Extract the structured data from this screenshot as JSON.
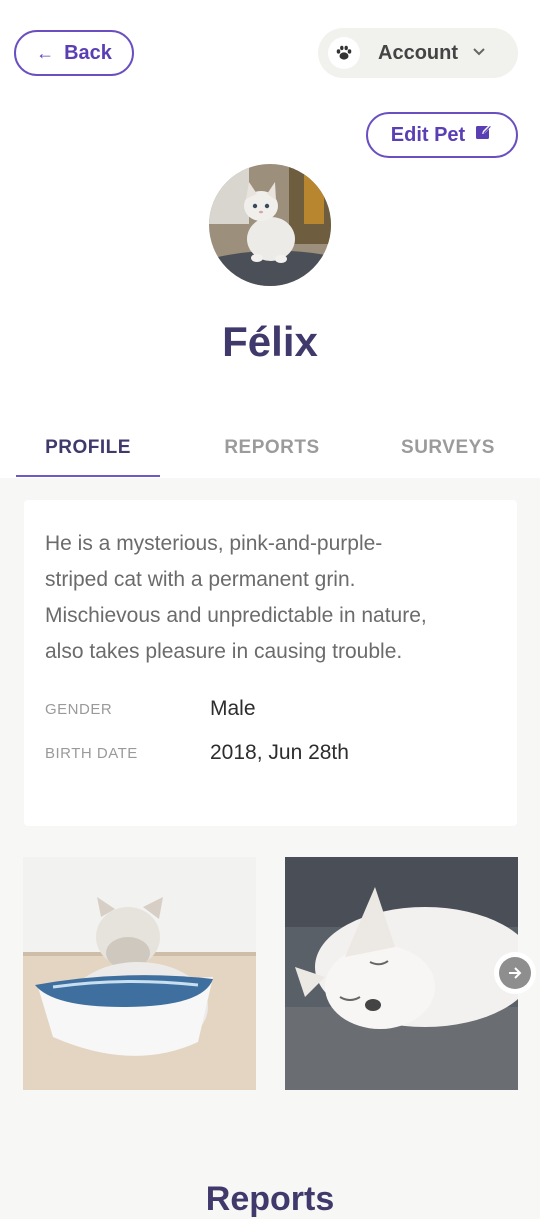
{
  "header": {
    "back_label": "Back",
    "account_label": "Account"
  },
  "actions": {
    "edit_pet_label": "Edit Pet"
  },
  "pet": {
    "name": "Félix",
    "description": "He is a mysterious, pink-and-purple-striped cat with a permanent grin. Mischievous and unpredictable in nature, also takes pleasure in causing trouble.",
    "fields": [
      {
        "label": "GENDER",
        "value": "Male"
      },
      {
        "label": "BIRTH DATE",
        "value": "2018, Jun 28th"
      }
    ]
  },
  "tabs": [
    {
      "label": "PROFILE",
      "active": true
    },
    {
      "label": "REPORTS",
      "active": false
    },
    {
      "label": "SURVEYS",
      "active": false
    }
  ],
  "gallery": {
    "photos": [
      "kitten-drinking-from-bowl",
      "kitten-sleeping"
    ]
  },
  "section": {
    "title": "Reports"
  },
  "colors": {
    "accent": "#6a4fc1",
    "heading": "#3f3a6b",
    "tab_inactive": "#9b9b9b",
    "page_bg": "#f7f7f5"
  },
  "icons": {
    "back": "arrow-left-icon",
    "account": "paw-icon",
    "dropdown": "chevron-down-icon",
    "edit": "edit-icon",
    "next": "arrow-right-icon"
  }
}
